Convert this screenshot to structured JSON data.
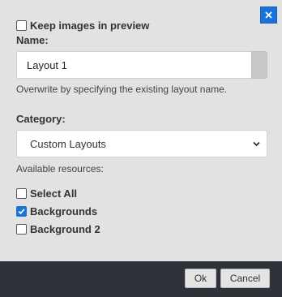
{
  "dialog": {
    "keep_images_label": "Keep images in preview",
    "keep_images_checked": false,
    "name_label": "Name:",
    "name_value": "Layout 1",
    "name_hint": "Overwrite by specifying the existing layout name.",
    "category_label": "Category:",
    "category_selected": "Custom Layouts",
    "resources_label": "Available resources:",
    "resources": [
      {
        "label": "Select All",
        "checked": false
      },
      {
        "label": "Backgrounds",
        "checked": true
      },
      {
        "label": "Background 2",
        "checked": false
      }
    ]
  },
  "footer": {
    "ok_label": "Ok",
    "cancel_label": "Cancel"
  },
  "colors": {
    "accent": "#1a73d9",
    "footer_bg": "#2e3239",
    "dialog_bg": "#e2e2e2"
  }
}
